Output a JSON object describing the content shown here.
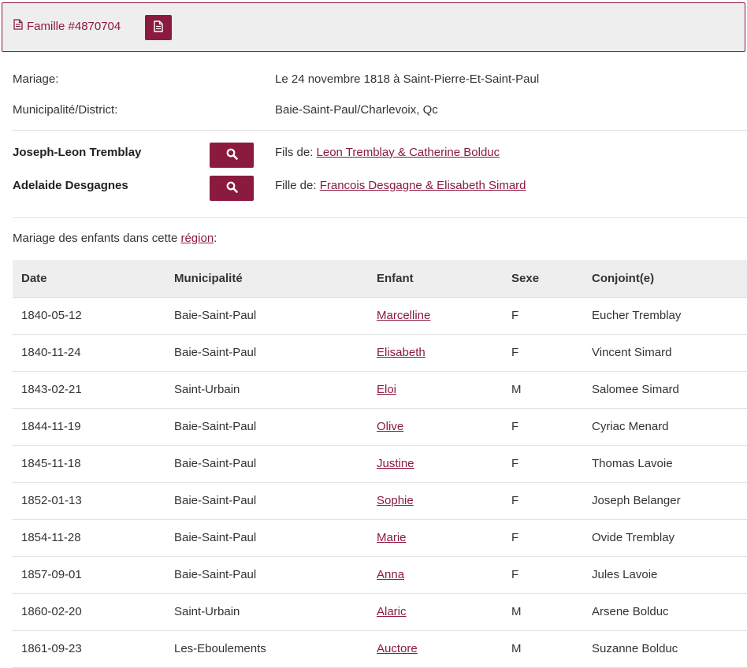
{
  "header": {
    "family_label": "Famille #4870704",
    "icons": {
      "family": "document-icon",
      "button": "document-icon"
    },
    "accent_color": "#8b1a3f"
  },
  "marriage": {
    "label": "Mariage:",
    "value": "Le 24 novembre 1818 à Saint-Pierre-Et-Saint-Paul"
  },
  "district": {
    "label": "Municipalité/District:",
    "value": "Baie-Saint-Paul/Charlevoix, Qc"
  },
  "spouses": [
    {
      "name": "Joseph-Leon Tremblay",
      "relation": "Fils de: ",
      "parents": "Leon Tremblay & Catherine Bolduc",
      "search_icon": "search-icon"
    },
    {
      "name": "Adelaide Desgagnes",
      "relation": "Fille de: ",
      "parents": "Francois Desgagne & Elisabeth Simard",
      "search_icon": "search-icon"
    }
  ],
  "children_section": {
    "intro_before": "Mariage des enfants dans cette ",
    "intro_link": "région",
    "intro_after": ":"
  },
  "table": {
    "headers": [
      "Date",
      "Municipalité",
      "Enfant",
      "Sexe",
      "Conjoint(e)"
    ],
    "rows": [
      {
        "date": "1840-05-12",
        "municipalite": "Baie-Saint-Paul",
        "enfant": "Marcelline",
        "sexe": "F",
        "conjoint": "Eucher Tremblay"
      },
      {
        "date": "1840-11-24",
        "municipalite": "Baie-Saint-Paul",
        "enfant": "Elisabeth",
        "sexe": "F",
        "conjoint": "Vincent Simard"
      },
      {
        "date": "1843-02-21",
        "municipalite": "Saint-Urbain",
        "enfant": "Eloi",
        "sexe": "M",
        "conjoint": "Salomee Simard"
      },
      {
        "date": "1844-11-19",
        "municipalite": "Baie-Saint-Paul",
        "enfant": "Olive",
        "sexe": "F",
        "conjoint": "Cyriac Menard"
      },
      {
        "date": "1845-11-18",
        "municipalite": "Baie-Saint-Paul",
        "enfant": "Justine",
        "sexe": "F",
        "conjoint": "Thomas Lavoie"
      },
      {
        "date": "1852-01-13",
        "municipalite": "Baie-Saint-Paul",
        "enfant": "Sophie",
        "sexe": "F",
        "conjoint": "Joseph Belanger"
      },
      {
        "date": "1854-11-28",
        "municipalite": "Baie-Saint-Paul",
        "enfant": "Marie",
        "sexe": "F",
        "conjoint": "Ovide Tremblay"
      },
      {
        "date": "1857-09-01",
        "municipalite": "Baie-Saint-Paul",
        "enfant": "Anna",
        "sexe": "F",
        "conjoint": "Jules Lavoie"
      },
      {
        "date": "1860-02-20",
        "municipalite": "Saint-Urbain",
        "enfant": "Alaric",
        "sexe": "M",
        "conjoint": "Arsene Bolduc"
      },
      {
        "date": "1861-09-23",
        "municipalite": "Les-Eboulements",
        "enfant": "Auctore",
        "sexe": "M",
        "conjoint": "Suzanne Bolduc"
      }
    ]
  }
}
